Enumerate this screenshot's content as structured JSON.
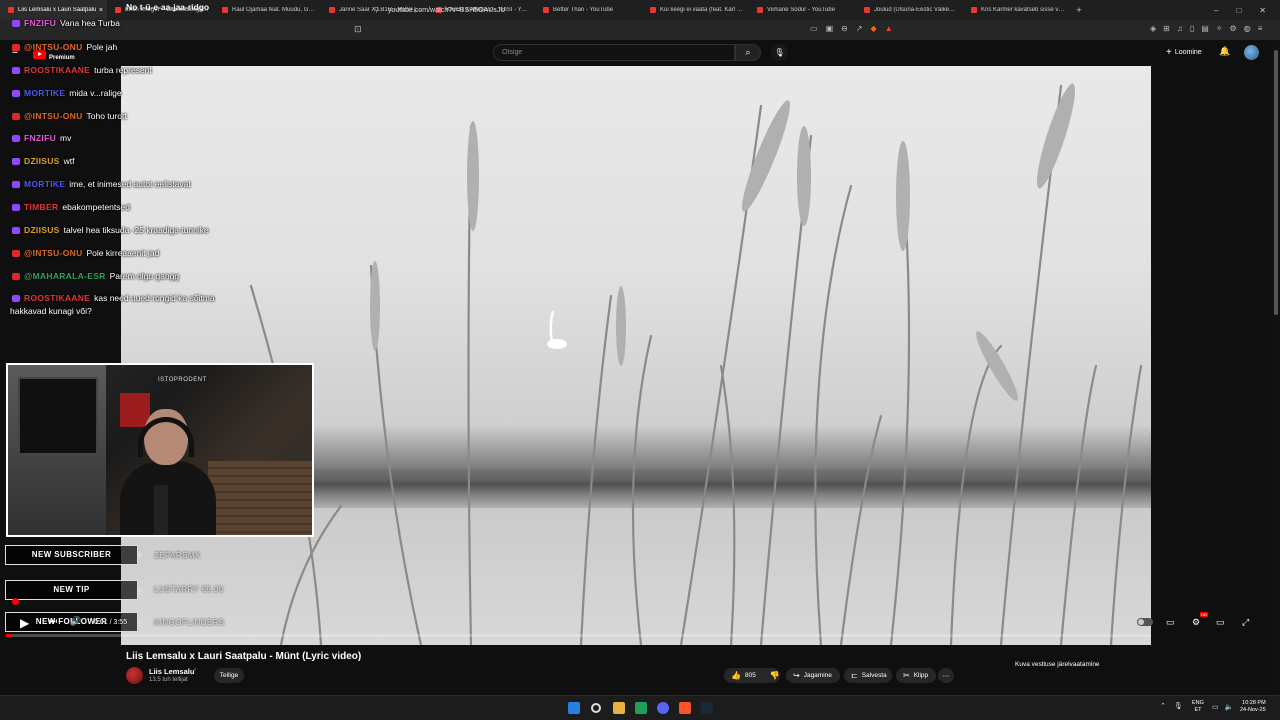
{
  "browser": {
    "tabs": [
      {
        "title": "Liis Lemsalu x Lauri Saatpalu",
        "active": true,
        "close": "×"
      },
      {
        "title": "Erich Krieger – Läänetuulega - You"
      },
      {
        "title": "Raul Ojamaa feat. Muudu, Gustav"
      },
      {
        "title": "Janne Saar X LB1R - MESI (Official"
      },
      {
        "title": "KIROT x NikitavZ - TEISI - YouTube"
      },
      {
        "title": "Better Than - YouTube"
      },
      {
        "title": "Kui keegi ei vaata (feat. Karl Killing)"
      },
      {
        "title": "Viimane Sõdur - YouTube"
      },
      {
        "title": "Jõulud (Ulsuna-Eestic Väikesed lim"
      },
      {
        "title": "Kris Kärmer kavatseb sisse võitsega"
      }
    ],
    "new_tab": "+",
    "window_controls": [
      "–",
      "□",
      "✕"
    ],
    "url": "youtube.com/watch?v=BSH5OAUsJU"
  },
  "youtube": {
    "logo_label": "Premium",
    "search_placeholder": "Otsige",
    "create_label": "Loomine"
  },
  "chat": {
    "top_line": "No t-ü-e-aa-jaa-ridgo",
    "messages": [
      {
        "platform": "tw",
        "user": "FNZIFU",
        "user_color": "#e25ad9",
        "text": "Vana hea Turba"
      },
      {
        "platform": "yt",
        "user": "@INTSU-ONU",
        "user_color": "#e0691f",
        "text": "Pole jah"
      },
      {
        "platform": "tw",
        "user": "ROOSTIKAANE",
        "user_color": "#e03838",
        "text": "turba represent"
      },
      {
        "platform": "tw",
        "user": "MORTIKE",
        "user_color": "#4b5ae6",
        "text": "mida v...ralige"
      },
      {
        "platform": "yt",
        "user": "@INTSU-ONU",
        "user_color": "#e0691f",
        "text": "Toho turott"
      },
      {
        "platform": "tw",
        "user": "FNZIFU",
        "user_color": "#e25ad9",
        "text": "mv"
      },
      {
        "platform": "tw",
        "user": "DZIISUS",
        "user_color": "#e0a11f",
        "text": "wtf"
      },
      {
        "platform": "tw",
        "user": "MORTIKE",
        "user_color": "#4b5ae6",
        "text": "ime, et inimesed autot eelistavat"
      },
      {
        "platform": "tw",
        "user": "TIMBER",
        "user_color": "#e03838",
        "text": "ebakompetentsed"
      },
      {
        "platform": "tw",
        "user": "DZIISUS",
        "user_color": "#e0a11f",
        "text": "talvel hea tiksuda -25 kraadiga tunnike"
      },
      {
        "platform": "yt",
        "user": "@INTSU-ONU",
        "user_color": "#e0691f",
        "text": "Pole kirreaaenit jad"
      },
      {
        "platform": "yt",
        "user": "@MAHARALA-ESR",
        "user_color": "#2ea65a",
        "text": "Parem olgu gangg"
      },
      {
        "platform": "tw",
        "user": "ROOSTIKAANE",
        "user_color": "#e03838",
        "text": "kas need uued rongid ka sõitma"
      }
    ],
    "continuation": "hakkavad kunagi või?"
  },
  "webcam": {
    "sign": "ISTOPRODENT"
  },
  "alerts": [
    {
      "label": "NEW SUBSCRIBER",
      "value": "ZEPARSMX"
    },
    {
      "label": "NEW TIP",
      "value": "LUSTARRY €5.00"
    },
    {
      "label": "NEW FOLLOWER",
      "value": "KINGOFLINDERS"
    }
  ],
  "player": {
    "progress": 0.005,
    "time": "0:01 / 3:55",
    "controls": {
      "play": "▶",
      "next": "⏭",
      "volume": "🔊",
      "subtitles": "▭",
      "settings": "⚙",
      "hd": "HD",
      "theater": "▭",
      "fullscreen": "⤢"
    }
  },
  "video": {
    "title": "Liis Lemsalu x Lauri Saatpalu - Münt (Lyric video)",
    "channel": "Liis Lemsalu",
    "verified": "✓",
    "subscribers": "13,5 tuh tellijat",
    "subscribe_label": "Tellige",
    "likes": "805",
    "share_label": "Jagamine",
    "save_label": "Salvesta",
    "clip_label": "Klipp",
    "more_label": "⋯",
    "chat_replay_label": "Kuva vestluse järelvaatamine"
  },
  "taskbar": {
    "lang_top": "ENG",
    "lang_bottom": "ET",
    "time": "10:28 PM",
    "date": "24-Nov-25"
  },
  "colors": {
    "accent": "#ff0000",
    "background": "#0f0f0f"
  }
}
